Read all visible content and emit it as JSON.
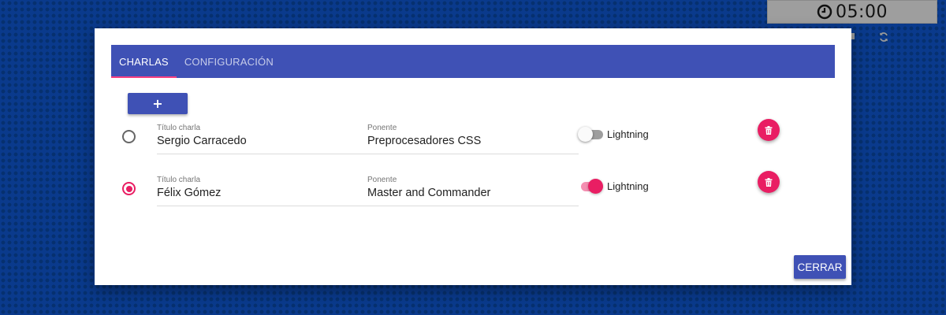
{
  "timer": {
    "text": "05:00",
    "icon": "clock-icon"
  },
  "background_controls": {
    "refresh_icon": "refresh-icon"
  },
  "dialog": {
    "tabs": [
      {
        "label": "CHARLAS",
        "active": true
      },
      {
        "label": "CONFIGURACIÓN",
        "active": false
      }
    ],
    "add_button_label": "+",
    "talks": [
      {
        "selected": false,
        "title_label": "Título charla",
        "title_value": "Sergio Carracedo",
        "speaker_label": "Ponente",
        "speaker_value": "Preprocesadores CSS",
        "lightning_label": "Lightning",
        "lightning_on": false,
        "delete_icon": "trash-icon"
      },
      {
        "selected": true,
        "title_label": "Título charla",
        "title_value": "Félix Gómez",
        "speaker_label": "Ponente",
        "speaker_value": "Master and Commander",
        "lightning_label": "Lightning",
        "lightning_on": true,
        "delete_icon": "trash-icon"
      }
    ],
    "close_button_label": "CERRAR"
  },
  "colors": {
    "primary": "#3f51b5",
    "accent": "#e91e63",
    "accent_light": "#f48fb1",
    "background": "#0a3a8c",
    "timer_bg": "#9e9e9e"
  }
}
